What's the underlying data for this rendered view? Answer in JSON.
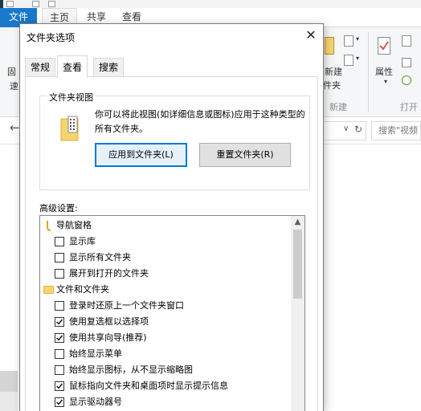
{
  "explorer": {
    "ribbon_tabs": [
      "文件",
      "主页",
      "共享",
      "查看"
    ],
    "left_cut_text": [
      "固",
      "速"
    ],
    "new_folder_label_top": "新建",
    "new_folder_label_bottom": "件夹",
    "new_group_label": "新建",
    "properties_label": "属性",
    "open_group_label": "打开",
    "search_placeholder": "搜索\"视频"
  },
  "dialog": {
    "title": "文件夹选项",
    "close_glyph": "✕",
    "tabs": [
      "常规",
      "查看",
      "搜索"
    ],
    "active_tab": "查看",
    "folder_view": {
      "title": "文件夹视图",
      "description": "你可以将此视图(如详细信息或图标)应用于这种类型的所有文件夹。",
      "apply_button": "应用到文件夹(L)",
      "reset_button": "重置文件夹(R)"
    },
    "advanced_label": "高级设置:",
    "settings": [
      {
        "type": "group",
        "icon": "navigation-pane-icon",
        "label": "导航窗格"
      },
      {
        "type": "checkbox",
        "label": "显示库",
        "checked": false
      },
      {
        "type": "checkbox",
        "label": "显示所有文件夹",
        "checked": false
      },
      {
        "type": "checkbox",
        "label": "展开到打开的文件夹",
        "checked": false
      },
      {
        "type": "group",
        "icon": "folder-icon",
        "label": "文件和文件夹"
      },
      {
        "type": "checkbox",
        "label": "登录时还原上一个文件夹窗口",
        "checked": false
      },
      {
        "type": "checkbox",
        "label": "使用复选框以选择项",
        "checked": true
      },
      {
        "type": "checkbox",
        "label": "使用共享向导(推荐)",
        "checked": true
      },
      {
        "type": "checkbox",
        "label": "始终显示菜单",
        "checked": false
      },
      {
        "type": "checkbox",
        "label": "始终显示图标，从不显示缩略图",
        "checked": false
      },
      {
        "type": "checkbox",
        "label": "鼠标指向文件夹和桌面项时显示提示信息",
        "checked": true
      },
      {
        "type": "checkbox",
        "label": "显示驱动器号",
        "checked": true
      }
    ]
  },
  "colors": {
    "accent": "#0078d7",
    "file_tab": "#1979ca",
    "folder": "#f6d56e"
  }
}
